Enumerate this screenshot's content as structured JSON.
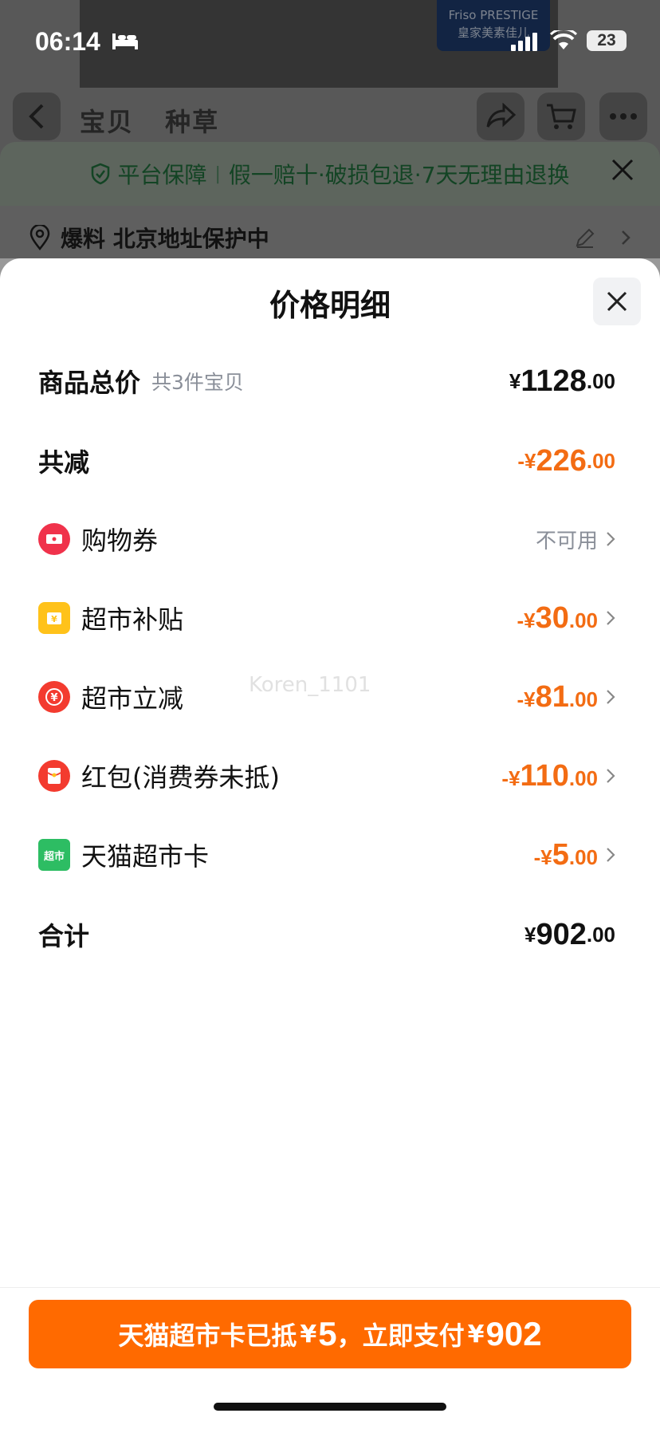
{
  "status_bar": {
    "time": "06:14",
    "battery": "23"
  },
  "background": {
    "brand_logo": "Friso PRESTIGE",
    "brand_logo_sub": "皇家美素佳儿",
    "nav_tabs": [
      "宝贝",
      "种草"
    ],
    "guarantee": {
      "label": "平台保障",
      "items": "假一赔十·破损包退·7天无理由退换"
    },
    "address": "爆料 北京地址保护中"
  },
  "sheet": {
    "title": "价格明细",
    "total_goods": {
      "label": "商品总价",
      "sub": "共3件宝贝",
      "cur": "¥",
      "int": "1128",
      "dec": ".00"
    },
    "total_discount": {
      "label": "共减",
      "cur": "-¥",
      "int": "226",
      "dec": ".00"
    },
    "items": [
      {
        "label": "购物券",
        "status": "不可用",
        "icon": "coupon-icon"
      },
      {
        "label": "超市补贴",
        "cur": "-¥",
        "int": "30",
        "dec": ".00",
        "icon": "subsidy-icon"
      },
      {
        "label": "超市立减",
        "cur": "-¥",
        "int": "81",
        "dec": ".00",
        "icon": "instant-discount-icon"
      },
      {
        "label": "红包(消费券未抵)",
        "cur": "-¥",
        "int": "110",
        "dec": ".00",
        "icon": "red-packet-icon"
      },
      {
        "label": "天猫超市卡",
        "cur": "-¥",
        "int": "5",
        "dec": ".00",
        "icon": "tmall-card-icon",
        "icon_text": "超市"
      }
    ],
    "total": {
      "label": "合计",
      "cur": "¥",
      "int": "902",
      "dec": ".00"
    },
    "watermark": "Koren_1101"
  },
  "pay_button": {
    "prefix": "天猫超市卡已抵",
    "card_amount": "5",
    "middle": "，立即支付",
    "pay_amount": "902",
    "yen": "¥"
  },
  "colors": {
    "accent": "#ff6a00",
    "discount": "#f36c13"
  }
}
